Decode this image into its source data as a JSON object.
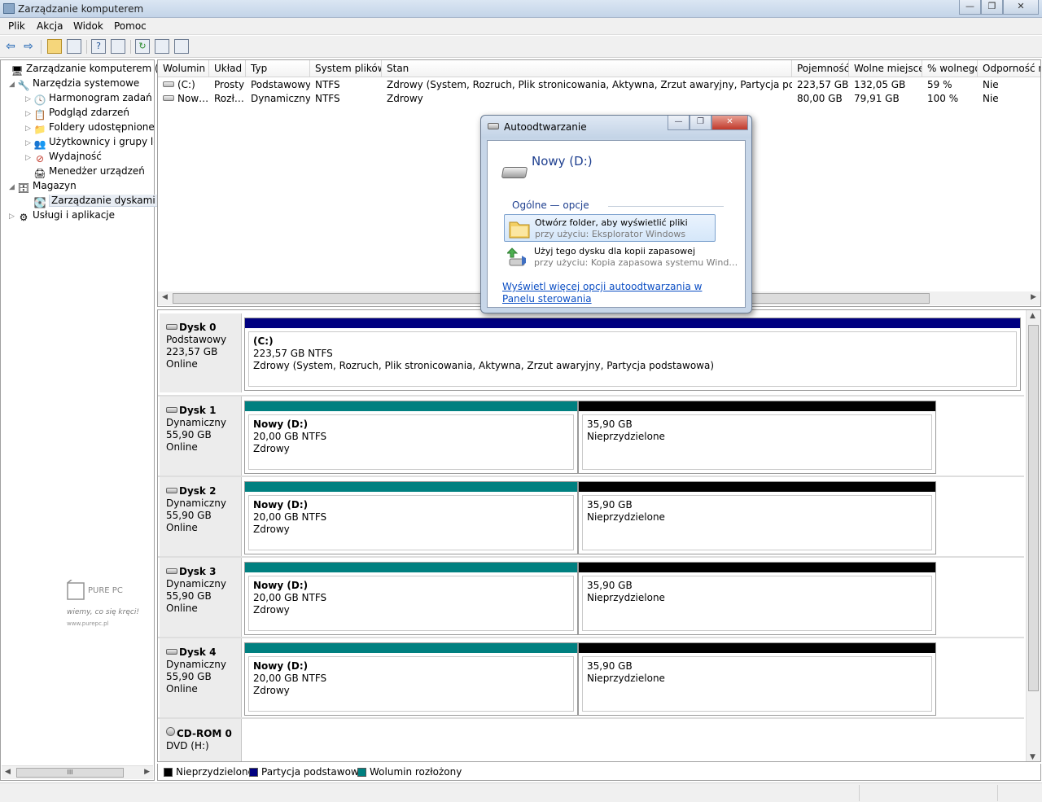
{
  "window": {
    "title": "Zarządzanie komputerem",
    "min_glyph": "—",
    "max_glyph": "❐",
    "close_glyph": "✕"
  },
  "menu": [
    "Plik",
    "Akcja",
    "Widok",
    "Pomoc"
  ],
  "toolbar": {
    "back_glyph": "⇦",
    "forward_glyph": "⇨",
    "help_glyph": "?",
    "refresh_glyph": "↻"
  },
  "tree": {
    "items": [
      {
        "label": "Zarządzanie komputerem (lokalne)",
        "icon": "computer-icon"
      },
      {
        "label": "Narzędzia systemowe",
        "icon": "tools-icon"
      },
      {
        "label": "Harmonogram zadań",
        "icon": "clock-icon"
      },
      {
        "label": "Podgląd zdarzeń",
        "icon": "event-viewer-icon"
      },
      {
        "label": "Foldery udostępnione",
        "icon": "shared-folder-icon"
      },
      {
        "label": "Użytkownicy i grupy lokalne",
        "icon": "users-icon"
      },
      {
        "label": "Wydajność",
        "icon": "performance-icon"
      },
      {
        "label": "Menedżer urządzeń",
        "icon": "device-manager-icon"
      },
      {
        "label": "Magazyn",
        "icon": "storage-icon"
      },
      {
        "label": "Zarządzanie dyskami",
        "icon": "disk-management-icon"
      },
      {
        "label": "Usługi i aplikacje",
        "icon": "services-icon"
      }
    ]
  },
  "volumes": {
    "columns": [
      "Wolumin",
      "Układ",
      "Typ",
      "System plików",
      "Stan",
      "Pojemność",
      "Wolne miejsce",
      "% wolnego",
      "Odporność na błędy"
    ],
    "rows": [
      [
        "(C:)",
        "Prosty",
        "Podstawowy",
        "NTFS",
        "Zdrowy (System, Rozruch, Plik stronicowania, Aktywna, Zrzut awaryjny, Partycja podstawowa)",
        "223,57 GB",
        "132,05 GB",
        "59 %",
        "Nie"
      ],
      [
        "Nowy (D:)",
        "Rozłożony",
        "Dynamiczny",
        "NTFS",
        "Zdrowy",
        "80,00 GB",
        "79,91 GB",
        "100 %",
        "Nie"
      ]
    ]
  },
  "disks": [
    {
      "name": "Dysk 0",
      "type": "Podstawowy",
      "size": "223,57 GB",
      "status": "Online",
      "partitions": [
        {
          "kind": "primary",
          "label": "(C:)",
          "line2": "223,57 GB NTFS",
          "line3": "Zdrowy (System, Rozruch, Plik stronicowania, Aktywna, Zrzut awaryjny, Partycja podstawowa)"
        }
      ]
    },
    {
      "name": "Dysk 1",
      "type": "Dynamiczny",
      "size": "55,90 GB",
      "status": "Online",
      "partitions": [
        {
          "kind": "spanned",
          "label": "Nowy  (D:)",
          "line2": "20,00 GB NTFS",
          "line3": "Zdrowy"
        },
        {
          "kind": "unallocated",
          "label": "",
          "line2": "35,90 GB",
          "line3": "Nieprzydzielone"
        }
      ]
    },
    {
      "name": "Dysk 2",
      "type": "Dynamiczny",
      "size": "55,90 GB",
      "status": "Online",
      "partitions": [
        {
          "kind": "spanned",
          "label": "Nowy  (D:)",
          "line2": "20,00 GB NTFS",
          "line3": "Zdrowy"
        },
        {
          "kind": "unallocated",
          "label": "",
          "line2": "35,90 GB",
          "line3": "Nieprzydzielone"
        }
      ]
    },
    {
      "name": "Dysk 3",
      "type": "Dynamiczny",
      "size": "55,90 GB",
      "status": "Online",
      "partitions": [
        {
          "kind": "spanned",
          "label": "Nowy  (D:)",
          "line2": "20,00 GB NTFS",
          "line3": "Zdrowy"
        },
        {
          "kind": "unallocated",
          "label": "",
          "line2": "35,90 GB",
          "line3": "Nieprzydzielone"
        }
      ]
    },
    {
      "name": "Dysk 4",
      "type": "Dynamiczny",
      "size": "55,90 GB",
      "status": "Online",
      "partitions": [
        {
          "kind": "spanned",
          "label": "Nowy  (D:)",
          "line2": "20,00 GB NTFS",
          "line3": "Zdrowy"
        },
        {
          "kind": "unallocated",
          "label": "",
          "line2": "35,90 GB",
          "line3": "Nieprzydzielone"
        }
      ]
    },
    {
      "name": "CD-ROM 0",
      "type": "DVD (H:)",
      "size": "",
      "status": "",
      "partitions": []
    }
  ],
  "colors": {
    "unallocated": "#000000",
    "primary": "#000080",
    "spanned": "#008080"
  },
  "legend": [
    {
      "label": "Nieprzydzielone",
      "color": "#000000"
    },
    {
      "label": "Partycja podstawowa",
      "color": "#000080"
    },
    {
      "label": "Wolumin rozłożony",
      "color": "#008080"
    }
  ],
  "autoplay": {
    "title": "Autoodtwarzanie",
    "device": "Nowy (D:)",
    "section": "Ogólne — opcje",
    "options": [
      {
        "title": "Otwórz folder, aby wyświetlić pliki",
        "subtitle": "przy użyciu: Eksplorator Windows",
        "icon": "folder-icon"
      },
      {
        "title": "Użyj tego dysku dla kopii zapasowej",
        "subtitle": "przy użyciu: Kopia zapasowa systemu Wind…",
        "icon": "backup-icon"
      }
    ],
    "link": "Wyświetl więcej opcji autoodtwarzania w Panelu sterowania"
  },
  "watermark": {
    "brand": "PURE PC",
    "slogan": "wiemy, co się kręci!",
    "url": "www.purepc.pl"
  }
}
